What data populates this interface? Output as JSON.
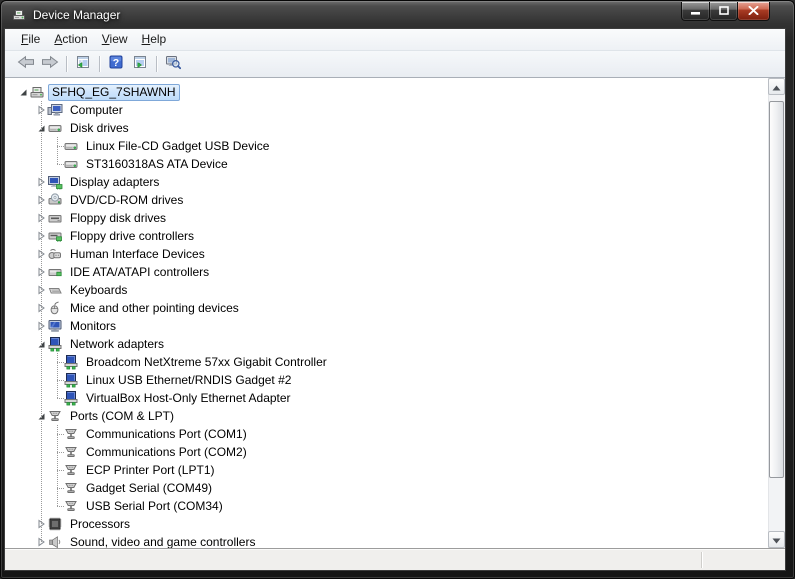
{
  "window": {
    "title": "Device Manager",
    "icon": "devmgr-icon",
    "buttons": [
      {
        "name": "minimize",
        "icon": "minimize-icon"
      },
      {
        "name": "restore",
        "icon": "restore-icon"
      },
      {
        "name": "close",
        "icon": "close-icon"
      }
    ]
  },
  "menubar": {
    "items": [
      {
        "label": "File",
        "underline_index": 0
      },
      {
        "label": "Action",
        "underline_index": 0
      },
      {
        "label": "View",
        "underline_index": 0
      },
      {
        "label": "Help",
        "underline_index": 0
      }
    ]
  },
  "toolbar": {
    "buttons": [
      {
        "type": "button",
        "name": "back",
        "icon": "back-arrow-icon"
      },
      {
        "type": "button",
        "name": "forward",
        "icon": "forward-arrow-icon"
      },
      {
        "type": "separator"
      },
      {
        "type": "button",
        "name": "show-hide-console-tree",
        "icon": "console-tree-icon"
      },
      {
        "type": "separator"
      },
      {
        "type": "button",
        "name": "help",
        "icon": "help-icon"
      },
      {
        "type": "button",
        "name": "show-hide-action-pane",
        "icon": "action-pane-icon"
      },
      {
        "type": "separator"
      },
      {
        "type": "button",
        "name": "scan-for-hardware-changes",
        "icon": "scan-hardware-icon"
      }
    ]
  },
  "tree": {
    "items": [
      {
        "label": "SFHQ_EG_7SHAWNH",
        "level": 0,
        "state": "expanded",
        "icon": "computer-root-icon",
        "selected": true
      },
      {
        "label": "Computer",
        "level": 1,
        "state": "collapsed",
        "icon": "computer-icon"
      },
      {
        "label": "Disk drives",
        "level": 1,
        "state": "expanded",
        "icon": "disk-icon"
      },
      {
        "label": "Linux File-CD Gadget USB Device",
        "level": 2,
        "state": "leaf",
        "icon": "disk-icon"
      },
      {
        "label": "ST3160318AS ATA Device",
        "level": 2,
        "state": "leaf",
        "icon": "disk-icon"
      },
      {
        "label": "Display adapters",
        "level": 1,
        "state": "collapsed",
        "icon": "display-icon"
      },
      {
        "label": "DVD/CD-ROM drives",
        "level": 1,
        "state": "collapsed",
        "icon": "dvd-icon"
      },
      {
        "label": "Floppy disk drives",
        "level": 1,
        "state": "collapsed",
        "icon": "floppy-icon"
      },
      {
        "label": "Floppy drive controllers",
        "level": 1,
        "state": "collapsed",
        "icon": "floppy-controller-icon"
      },
      {
        "label": "Human Interface Devices",
        "level": 1,
        "state": "collapsed",
        "icon": "hid-icon"
      },
      {
        "label": "IDE ATA/ATAPI controllers",
        "level": 1,
        "state": "collapsed",
        "icon": "ide-icon"
      },
      {
        "label": "Keyboards",
        "level": 1,
        "state": "collapsed",
        "icon": "keyboard-icon"
      },
      {
        "label": "Mice and other pointing devices",
        "level": 1,
        "state": "collapsed",
        "icon": "mouse-icon"
      },
      {
        "label": "Monitors",
        "level": 1,
        "state": "collapsed",
        "icon": "monitor-icon"
      },
      {
        "label": "Network adapters",
        "level": 1,
        "state": "expanded",
        "icon": "network-icon"
      },
      {
        "label": "Broadcom NetXtreme 57xx Gigabit Controller",
        "level": 2,
        "state": "leaf",
        "icon": "network-icon"
      },
      {
        "label": "Linux USB Ethernet/RNDIS Gadget #2",
        "level": 2,
        "state": "leaf",
        "icon": "network-icon"
      },
      {
        "label": "VirtualBox Host-Only Ethernet Adapter",
        "level": 2,
        "state": "leaf",
        "icon": "network-icon"
      },
      {
        "label": "Ports (COM & LPT)",
        "level": 1,
        "state": "expanded",
        "icon": "port-icon"
      },
      {
        "label": "Communications Port (COM1)",
        "level": 2,
        "state": "leaf",
        "icon": "port-icon"
      },
      {
        "label": "Communications Port (COM2)",
        "level": 2,
        "state": "leaf",
        "icon": "port-icon"
      },
      {
        "label": "ECP Printer Port (LPT1)",
        "level": 2,
        "state": "leaf",
        "icon": "port-icon"
      },
      {
        "label": "Gadget Serial (COM49)",
        "level": 2,
        "state": "leaf",
        "icon": "port-icon"
      },
      {
        "label": "USB Serial Port (COM34)",
        "level": 2,
        "state": "leaf",
        "icon": "port-icon"
      },
      {
        "label": "Processors",
        "level": 1,
        "state": "collapsed",
        "icon": "processor-icon"
      },
      {
        "label": "Sound, video and game controllers",
        "level": 1,
        "state": "collapsed",
        "icon": "sound-icon"
      }
    ]
  },
  "statusbar": {
    "text": ""
  },
  "colors": {
    "selection_fill": "#cfe5fc",
    "selection_border": "#7fa8d9",
    "close_button_red": "#a93b24",
    "help_button_blue": "#3f6bd0",
    "led_green": "#3cb54d",
    "screen_blue": "#2f55b8",
    "titlebar_text": "#ffffff",
    "tree_line": "#9a9a9a"
  }
}
